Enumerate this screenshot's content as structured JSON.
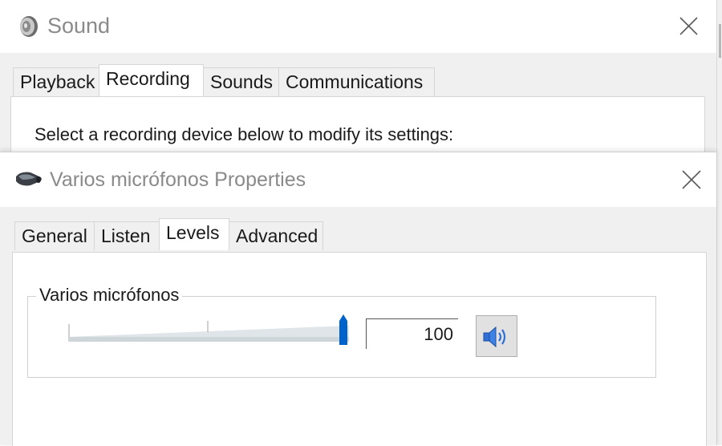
{
  "sound_window": {
    "title": "Sound",
    "tabs": [
      {
        "label": "Playback"
      },
      {
        "label": "Recording"
      },
      {
        "label": "Sounds"
      },
      {
        "label": "Communications"
      }
    ],
    "active_tab": "Recording",
    "instruction": "Select a recording device below to modify its settings:"
  },
  "properties_window": {
    "title": "Varios micrófonos Properties",
    "tabs": [
      {
        "label": "General"
      },
      {
        "label": "Listen"
      },
      {
        "label": "Levels"
      },
      {
        "label": "Advanced"
      }
    ],
    "active_tab": "Levels",
    "levels": {
      "group_label": "Varios micrófonos",
      "volume_value": "100",
      "volume_fraction": 1.0,
      "mute_icon": "speaker-icon"
    }
  },
  "colors": {
    "slider_thumb": "#0063cc",
    "slider_track": "#d7dde0",
    "title_text": "#8a8a8a"
  }
}
